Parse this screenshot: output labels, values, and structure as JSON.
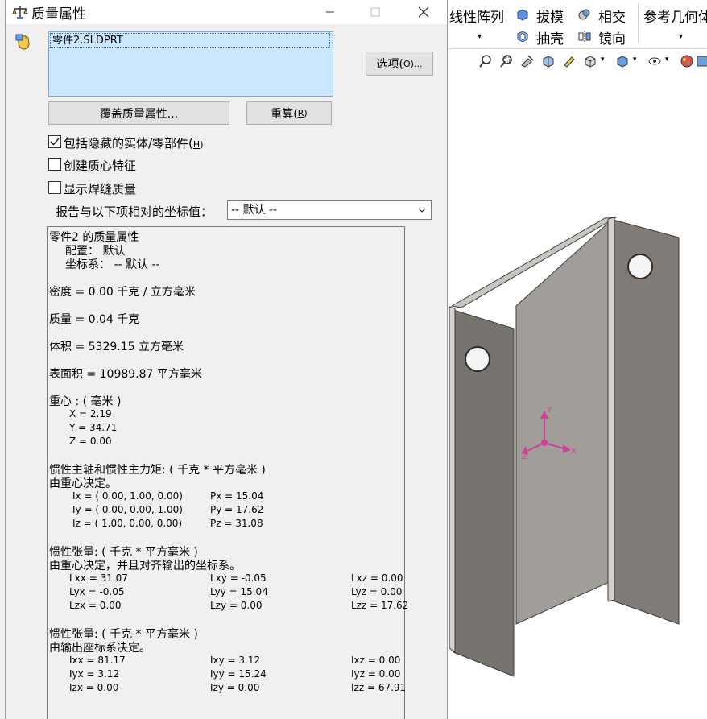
{
  "dialog": {
    "title": "质量属性",
    "part_item": "零件2.SLDPRT",
    "options_label": "选项(",
    "options_key": "O",
    "options_suffix": ")...",
    "override_label": "覆盖质量属性...",
    "recalc_label": "重算(",
    "recalc_key": "R",
    "recalc_suffix": ")",
    "checkboxes": [
      {
        "label": "包括隐藏的实体/零部件(",
        "key": "H",
        "suffix": ")",
        "checked": true
      },
      {
        "label": "创建质心特征",
        "checked": false
      },
      {
        "label": "显示焊缝质量",
        "checked": false
      }
    ],
    "coord_label": "报告与以下项相对的坐标值：",
    "coord_value": "-- 默认 --"
  },
  "results": {
    "header": "零件2 的质量属性",
    "config": "配置：  默认",
    "coord_sys": "坐标系：  -- 默认 --",
    "density": "密度 = 0.00 千克 / 立方毫米",
    "mass": "质量 = 0.04 千克",
    "volume": "体积 = 5329.15 立方毫米",
    "area": "表面积 = 10989.87  平方毫米",
    "com_title": "重心 : ( 毫米 )",
    "com": [
      "X = 2.19",
      "Y = 34.71",
      "Z = 0.00"
    ],
    "principal_title": "惯性主轴和惯性主力矩: ( 千克 *  平方毫米 )",
    "principal_sub": "由重心决定。",
    "principal_axes": [
      "Ix = ( 0.00,  1.00,  0.00)",
      "Iy = ( 0.00,  0.00,  1.00)",
      "Iz = ( 1.00,  0.00,  0.00)"
    ],
    "principal_moments": [
      "Px = 15.04",
      "Py = 17.62",
      "Pz = 31.08"
    ],
    "tensor1_title": "惯性张量: ( 千克 *  平方毫米 )",
    "tensor1_sub": "由重心决定，并且对齐输出的坐标系。",
    "tensor1": [
      [
        "Lxx = 31.07",
        "Lxy = -0.05",
        "Lxz = 0.00"
      ],
      [
        "Lyx = -0.05",
        "Lyy = 15.04",
        "Lyz = 0.00"
      ],
      [
        "Lzx = 0.00",
        "Lzy = 0.00",
        "Lzz = 17.62"
      ]
    ],
    "tensor2_title": "惯性张量: ( 千克 *  平方毫米 )",
    "tensor2_sub": "由输出座标系决定。",
    "tensor2": [
      [
        "Ixx = 81.17",
        "Ixy = 3.12",
        "Ixz = 0.00"
      ],
      [
        "Iyx = 3.12",
        "Iyy = 15.24",
        "Iyz = 0.00"
      ],
      [
        "Izx = 0.00",
        "Izy = 0.00",
        "Izz = 67.91"
      ]
    ]
  },
  "ribbon": {
    "linear_pattern": "线性阵列",
    "draft": "拔模",
    "intersect": "相交",
    "reference_geometry": "参考几何体",
    "shell": "抽壳",
    "mirror": "镜向"
  },
  "triad": {
    "x": "X",
    "y": "Y",
    "z": "Z"
  },
  "colors": {
    "list_bg": "#cce8ff",
    "dialog_bg": "#f0f0f0",
    "part_gray": "#8f8c88",
    "triad": "#d0409a"
  }
}
